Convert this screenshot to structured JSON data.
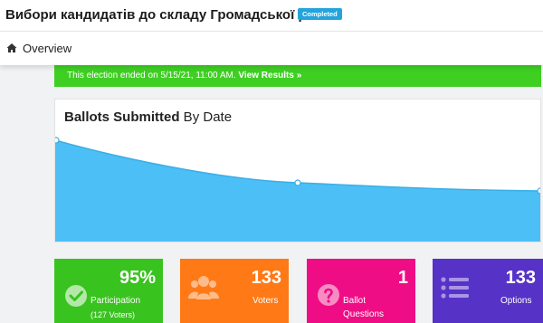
{
  "header": {
    "title": "Вибори кандидатів до складу Громадської ра...",
    "status": "Completed"
  },
  "nav": {
    "overview_label": "Overview"
  },
  "alert": {
    "message": "This election ended on 5/15/21, 11:00 AM.",
    "link_label": "View Results »"
  },
  "chart_card": {
    "title_bold": "Ballots Submitted",
    "title_rest": " By Date",
    "area_color": "#4cbff6",
    "line_color": "#3aaee6"
  },
  "stats": [
    {
      "value": "95%",
      "label": "Participation",
      "sublabel": "(127 Voters)",
      "icon": "check-circle-icon",
      "color": "#39c31f"
    },
    {
      "value": "133",
      "label": "Voters",
      "icon": "users-icon",
      "color": "#ff7916"
    },
    {
      "value": "1",
      "label": "Ballot",
      "sublabel": "Questions",
      "icon": "question-icon",
      "color": "#ee0d85"
    },
    {
      "value": "133",
      "label": "Options",
      "icon": "list-icon",
      "color": "#5632c7"
    }
  ]
}
